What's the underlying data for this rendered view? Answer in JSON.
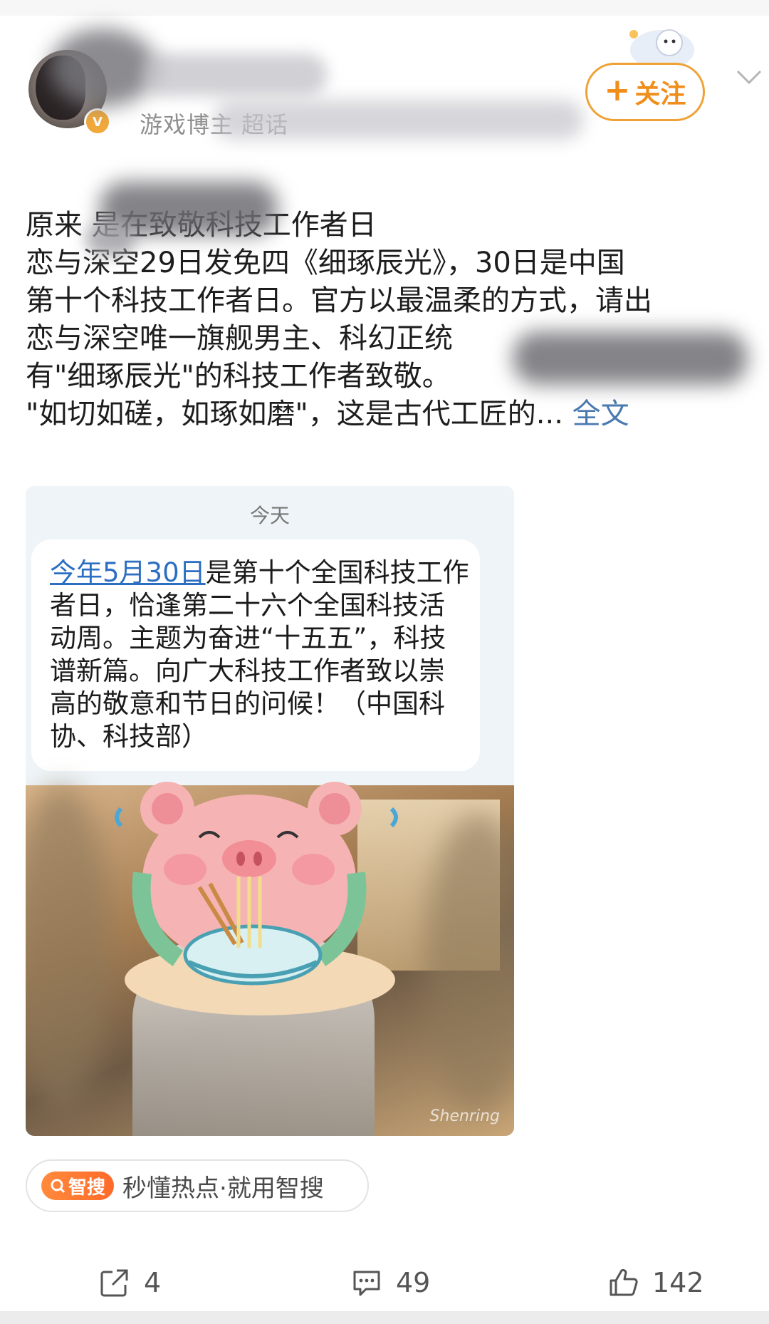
{
  "header": {
    "username": "",
    "subline": "游戏博主 超话",
    "avatar_badge": "V",
    "follow_label": "关注",
    "follow_plus": "+"
  },
  "post": {
    "lines": [
      "原来            是在致敬科技工作者日",
      "恋与深空29日发免四《细琢辰光》，30日是中国",
      "第十个科技工作者日。官方以最温柔的方式，请出",
      "恋与深空唯一旗舰男主、科幻正统",
      "有\"细琢辰光\"的科技工作者致敬。",
      "\"如切如磋，如琢如磨\"，这是古代工匠的..."
    ],
    "more_label": "全文"
  },
  "media": {
    "date_label": "今天",
    "bubble_link": "今年5月30日",
    "bubble_text": "是第十个全国科技工作者日，恰逢第二十六个全国科技活动周。主题为奋进“十五五”，科技谱新篇。向广大科技工作者致以崇高的敬意和节日的问候！（中国科协、科技部）",
    "watermark": "Shenring"
  },
  "tag": {
    "badge": "智搜",
    "text": "秒懂热点·就用智搜"
  },
  "actions": {
    "share_count": "4",
    "comment_count": "49",
    "like_count": "142"
  },
  "colors": {
    "accent_orange": "#f0a135",
    "link_blue": "#4a79b0",
    "tag_orange": "#ff7a30"
  }
}
